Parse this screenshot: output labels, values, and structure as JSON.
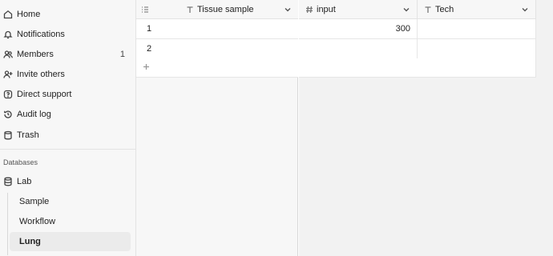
{
  "sidebar": {
    "nav": [
      {
        "label": "Home",
        "icon": "home-icon"
      },
      {
        "label": "Notifications",
        "icon": "bell-icon"
      },
      {
        "label": "Members",
        "icon": "members-icon",
        "count": "1"
      },
      {
        "label": "Invite others",
        "icon": "invite-user-icon"
      },
      {
        "label": "Direct support",
        "icon": "help-icon"
      },
      {
        "label": "Audit log",
        "icon": "history-icon"
      },
      {
        "label": "Trash",
        "icon": "trash-icon"
      }
    ],
    "section_label": "Databases",
    "database": {
      "label": "Lab",
      "icon": "database-icon"
    },
    "tables": [
      {
        "label": "Sample",
        "active": false
      },
      {
        "label": "Workflow",
        "active": false
      },
      {
        "label": "Lung",
        "active": true
      }
    ]
  },
  "grid": {
    "columns": [
      {
        "label": "Tissue sample",
        "type_icon": "text-type-icon"
      },
      {
        "label": "input",
        "type_icon": "number-type-icon"
      },
      {
        "label": "Tech",
        "type_icon": "text-type-icon"
      }
    ],
    "rows": [
      {
        "id": "1",
        "input": "300",
        "tech": ""
      },
      {
        "id": "2",
        "input": "",
        "tech": ""
      }
    ]
  },
  "colors": {
    "sidebar_bg": "#f7f7f7",
    "active_item_bg": "#ebebeb",
    "canvas_bg": "#f2f2f2",
    "border": "#e3e3e3"
  }
}
